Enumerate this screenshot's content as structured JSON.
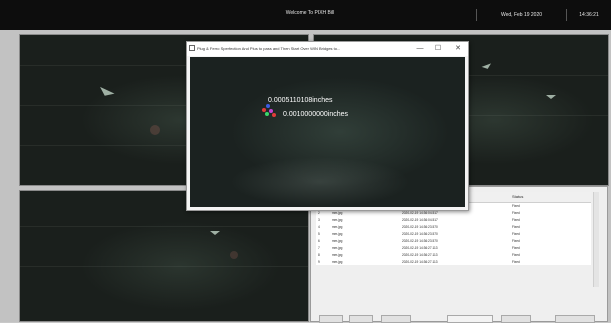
{
  "header": {
    "title": "Welcome To PIXH Bill",
    "date": "Wed, Feb 19 2020",
    "time": "14:36:21"
  },
  "popup": {
    "title": "Plug & Ferro Sperfection And Plus to pass and Then Start Over WIN Bridges to...",
    "minimize_glyph": "—",
    "maximize_glyph": "☐",
    "close_glyph": "✕",
    "measurement_1": "0.0005110108inches",
    "measurement_2": "0.0010000000inches"
  },
  "log_table": {
    "columns": [
      "",
      "",
      "Time",
      "Status"
    ],
    "rows": [
      {
        "num": "1",
        "file": "mm.jpg",
        "time": "2020-02-19 14:36:04.517",
        "status": "Fixed"
      },
      {
        "num": "2",
        "file": "mm.jpg",
        "time": "2020-02-19 14:36:04.517",
        "status": "Fixed"
      },
      {
        "num": "3",
        "file": "mm.jpg",
        "time": "2020-02-19 14:36:04.517",
        "status": "Fixed"
      },
      {
        "num": "4",
        "file": "mm.jpg",
        "time": "2020-02-19 14:36:23.570",
        "status": "Fixed"
      },
      {
        "num": "5",
        "file": "mm.jpg",
        "time": "2020-02-19 14:36:23.570",
        "status": "Fixed"
      },
      {
        "num": "6",
        "file": "mm.jpg",
        "time": "2020-02-19 14:36:23.570",
        "status": "Fixed"
      },
      {
        "num": "7",
        "file": "mm.jpg",
        "time": "2020-02-19 14:36:27.113",
        "status": "Fixed"
      },
      {
        "num": "8",
        "file": "mm.jpg",
        "time": "2020-02-19 14:36:27.113",
        "status": "Fixed"
      },
      {
        "num": "9",
        "file": "mm.jpg",
        "time": "2020-02-19 14:36:27.113",
        "status": "Fixed"
      }
    ]
  },
  "colors": {
    "topbar": "#0d0d0d",
    "camera_bg": "#1a1f1c",
    "panel_bg": "#efefef"
  }
}
